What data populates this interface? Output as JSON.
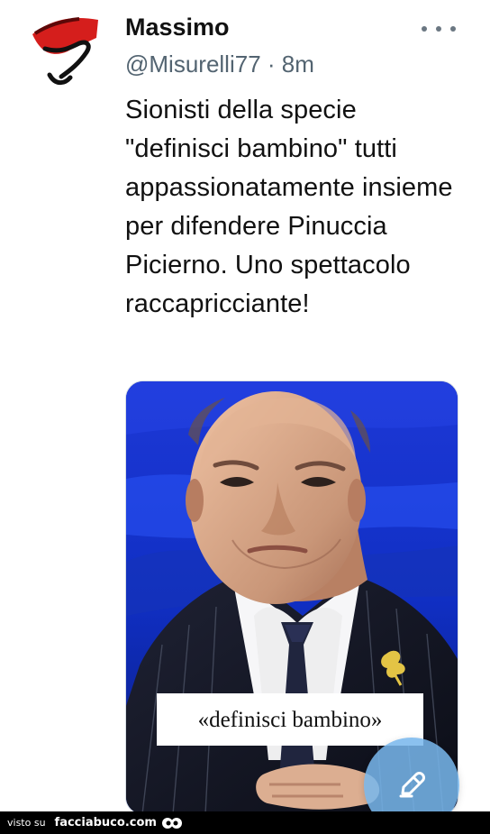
{
  "tweet": {
    "author_name": "Massimo",
    "handle": "@Misurelli77",
    "separator": "·",
    "timestamp": "8m",
    "text": "Sionisti della specie \"definisci bambino\" tutti appassionatamente insieme per difendere Pinuccia Picierno. Uno spettacolo raccapricciante!",
    "media_caption": "«definisci bambino»"
  },
  "icons": {
    "more": "more-horizontal-icon",
    "compose": "compose-icon",
    "mascot": "eyes-icon"
  },
  "footer": {
    "prefix": "visto su",
    "site": "facciabuco.com"
  },
  "colors": {
    "secondary_text": "#536471",
    "media_background": "#0d2bb9",
    "compose_button": "#78b7ec",
    "footer_background": "#000000"
  }
}
